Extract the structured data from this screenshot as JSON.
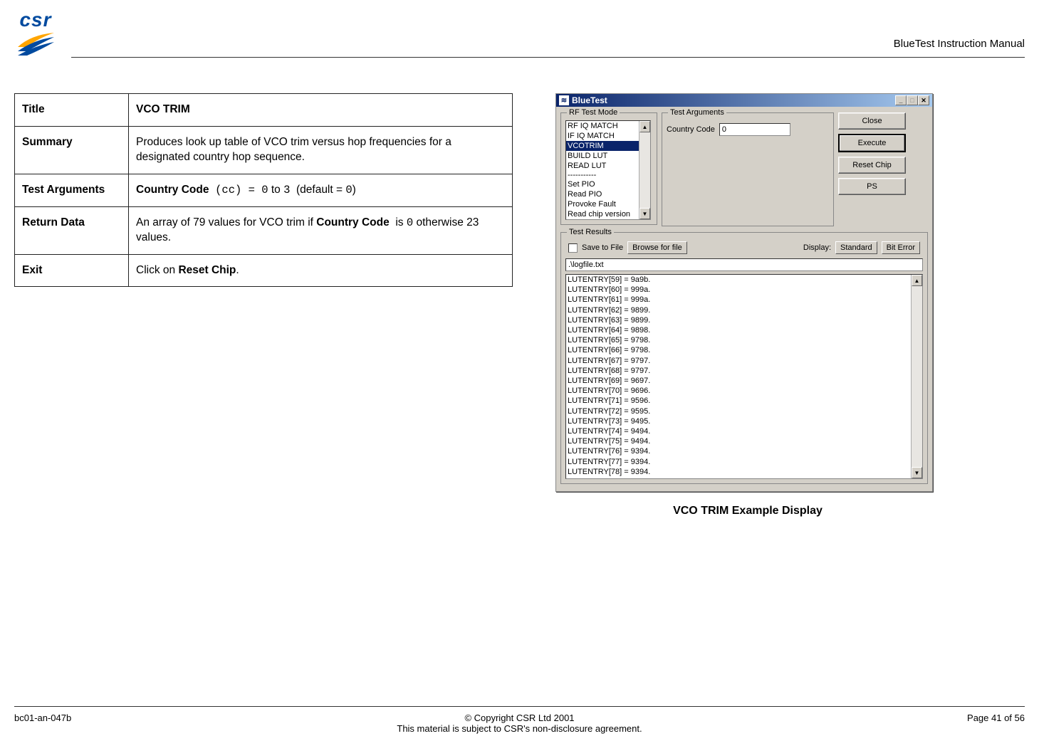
{
  "header": {
    "logo_text": "csr",
    "doc_title": "BlueTest Instruction Manual"
  },
  "table": {
    "rows": [
      {
        "label": "Title",
        "value_html": "<span class='bold'>VCO TRIM</span>"
      },
      {
        "label": "Summary",
        "value_html": "Produces look up table of VCO trim versus hop frequencies for a designated country hop sequence."
      },
      {
        "label": "Test Arguments",
        "value_html": "<span class='bold'>Country Code</span> &nbsp;<span class='code'>(cc) = 0</span> to <span class='code'>3</span>&nbsp; (default = <span class='code'>0</span>)"
      },
      {
        "label": "Return Data",
        "value_html": "An array of 79 values for VCO trim if <span class='bold'>Country Code</span>&nbsp; is <span class='code'>0</span> otherwise 23 values."
      },
      {
        "label": "Exit",
        "value_html": "Click on <span class='bold'>Reset Chip</span>."
      }
    ]
  },
  "window": {
    "title": "BlueTest",
    "rf_group": "RF Test Mode",
    "rf_items": [
      {
        "label": "RF IQ MATCH",
        "sel": false
      },
      {
        "label": "IF IQ MATCH",
        "sel": false
      },
      {
        "label": "VCOTRIM",
        "sel": true
      },
      {
        "label": "BUILD LUT",
        "sel": false
      },
      {
        "label": "READ LUT",
        "sel": false
      }
    ],
    "rf_separator": "-----------",
    "rf_items2": [
      {
        "label": "Set PIO",
        "sel": false
      },
      {
        "label": "Read PIO",
        "sel": false
      },
      {
        "label": "Provoke Fault",
        "sel": false
      },
      {
        "label": "Read chip version",
        "sel": false
      }
    ],
    "args_group": "Test Arguments",
    "args": {
      "country_code_label": "Country Code",
      "country_code_value": "0"
    },
    "buttons": {
      "close": "Close",
      "execute": "Execute",
      "reset": "Reset Chip",
      "ps": "PS"
    },
    "results_group": "Test Results",
    "save_to_file": "Save to File",
    "browse": "Browse for file",
    "display_label": "Display:",
    "display_standard": "Standard",
    "display_biterror": "Bit Error",
    "logfile": ".\\logfile.txt",
    "results": [
      "LUTENTRY[59] = 9a9b.",
      "LUTENTRY[60] = 999a.",
      "LUTENTRY[61] = 999a.",
      "LUTENTRY[62] = 9899.",
      "LUTENTRY[63] = 9899.",
      "LUTENTRY[64] = 9898.",
      "LUTENTRY[65] = 9798.",
      "LUTENTRY[66] = 9798.",
      "LUTENTRY[67] = 9797.",
      "LUTENTRY[68] = 9797.",
      "LUTENTRY[69] = 9697.",
      "LUTENTRY[70] = 9696.",
      "LUTENTRY[71] = 9596.",
      "LUTENTRY[72] = 9595.",
      "LUTENTRY[73] = 9495.",
      "LUTENTRY[74] = 9494.",
      "LUTENTRY[75] = 9494.",
      "LUTENTRY[76] = 9394.",
      "LUTENTRY[77] = 9394.",
      "LUTENTRY[78] = 9394."
    ]
  },
  "caption": "VCO TRIM Example Display",
  "footer": {
    "left": "bc01-an-047b",
    "center1": "© Copyright CSR Ltd 2001",
    "center2": "This material is subject to CSR's non-disclosure agreement.",
    "right": "Page 41 of 56"
  }
}
